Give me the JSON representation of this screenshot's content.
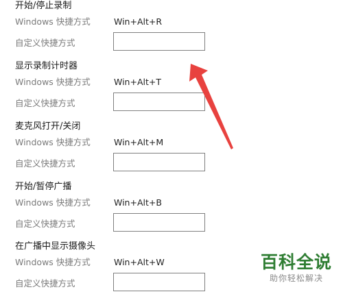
{
  "sections": [
    {
      "title": "开始/停止录制",
      "windows_label": "Windows 快捷方式",
      "shortcut": "Win+Alt+R",
      "custom_label": "自定义快捷方式",
      "custom_value": ""
    },
    {
      "title": "显示录制计时器",
      "windows_label": "Windows 快捷方式",
      "shortcut": "Win+Alt+T",
      "custom_label": "自定义快捷方式",
      "custom_value": ""
    },
    {
      "title": "麦克风打开/关闭",
      "windows_label": "Windows 快捷方式",
      "shortcut": "Win+Alt+M",
      "custom_label": "自定义快捷方式",
      "custom_value": ""
    },
    {
      "title": "开始/暂停广播",
      "windows_label": "Windows 快捷方式",
      "shortcut": "Win+Alt+B",
      "custom_label": "自定义快捷方式",
      "custom_value": ""
    },
    {
      "title": "在广播中显示摄像头",
      "windows_label": "Windows 快捷方式",
      "shortcut": "Win+Alt+W",
      "custom_label": "自定义快捷方式",
      "custom_value": ""
    }
  ],
  "watermark": {
    "title": "百科全说",
    "subtitle": "助你轻松解决",
    "color": "#2e7d32"
  },
  "annotation": {
    "arrow_color": "#e8423f"
  }
}
